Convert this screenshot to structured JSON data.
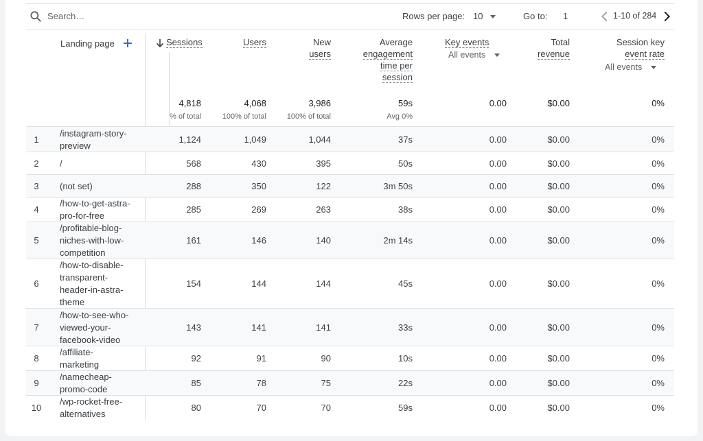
{
  "toolbar": {
    "search_placeholder": "Search…",
    "rows_per_page_label": "Rows per page:",
    "rows_per_page_value": "10",
    "goto_label": "Go to:",
    "goto_value": "1",
    "range_text": "1-10 of 284"
  },
  "columns": {
    "landing_page": "Landing page",
    "sessions": "Sessions",
    "users": "Users",
    "new_users_1": "New",
    "new_users_2": "users",
    "aet_1": "Average",
    "aet_2": "engagement",
    "aet_3": "time per",
    "aet_4": "session",
    "key_events": "Key events",
    "key_events_sub": "All events",
    "revenue_1": "Total",
    "revenue_2": "revenue",
    "skr_1": "Session key",
    "skr_2": "event rate",
    "skr_sub": "All events"
  },
  "totals": {
    "sessions": "4,818",
    "sessions_sub": "% of total",
    "users": "4,068",
    "users_sub": "100% of total",
    "new_users": "3,986",
    "new_users_sub": "100% of total",
    "aet": "59s",
    "aet_sub": "Avg 0%",
    "key_events": "0.00",
    "revenue": "$0.00",
    "skr": "0%"
  },
  "rows": [
    {
      "idx": "1",
      "page": "/instagram-story-preview",
      "sessions": "1,124",
      "users": "1,049",
      "new_users": "1,044",
      "aet": "37s",
      "key_events": "0.00",
      "revenue": "$0.00",
      "skr": "0%"
    },
    {
      "idx": "2",
      "page": "/",
      "sessions": "568",
      "users": "430",
      "new_users": "395",
      "aet": "50s",
      "key_events": "0.00",
      "revenue": "$0.00",
      "skr": "0%"
    },
    {
      "idx": "3",
      "page": "(not set)",
      "sessions": "288",
      "users": "350",
      "new_users": "122",
      "aet": "3m 50s",
      "key_events": "0.00",
      "revenue": "$0.00",
      "skr": "0%"
    },
    {
      "idx": "4",
      "page": "/how-to-get-astra-pro-for-free",
      "sessions": "285",
      "users": "269",
      "new_users": "263",
      "aet": "38s",
      "key_events": "0.00",
      "revenue": "$0.00",
      "skr": "0%"
    },
    {
      "idx": "5",
      "page": "/profitable-blog-niches-with-low-competition",
      "sessions": "161",
      "users": "146",
      "new_users": "140",
      "aet": "2m 14s",
      "key_events": "0.00",
      "revenue": "$0.00",
      "skr": "0%"
    },
    {
      "idx": "6",
      "page": "/how-to-disable-transparent-header-in-astra-theme",
      "sessions": "154",
      "users": "144",
      "new_users": "144",
      "aet": "45s",
      "key_events": "0.00",
      "revenue": "$0.00",
      "skr": "0%"
    },
    {
      "idx": "7",
      "page": "/how-to-see-who-viewed-your-facebook-video",
      "sessions": "143",
      "users": "141",
      "new_users": "141",
      "aet": "33s",
      "key_events": "0.00",
      "revenue": "$0.00",
      "skr": "0%"
    },
    {
      "idx": "8",
      "page": "/affiliate-marketing",
      "sessions": "92",
      "users": "91",
      "new_users": "90",
      "aet": "10s",
      "key_events": "0.00",
      "revenue": "$0.00",
      "skr": "0%"
    },
    {
      "idx": "9",
      "page": "/namecheap-promo-code",
      "sessions": "85",
      "users": "78",
      "new_users": "75",
      "aet": "22s",
      "key_events": "0.00",
      "revenue": "$0.00",
      "skr": "0%"
    },
    {
      "idx": "10",
      "page": "/wp-rocket-free-alternatives",
      "sessions": "80",
      "users": "70",
      "new_users": "70",
      "aet": "59s",
      "key_events": "0.00",
      "revenue": "$0.00",
      "skr": "0%"
    }
  ],
  "icons": {
    "search": "search-icon",
    "add": "add-icon",
    "sort": "arrow-down-icon",
    "prev": "chevron-left-icon",
    "next": "chevron-right-icon",
    "dropdown": "caret-down-icon"
  },
  "colors": {
    "accent": "#1a73e8",
    "row_alt": "#f8f9fa",
    "border": "#e0e0e0"
  }
}
